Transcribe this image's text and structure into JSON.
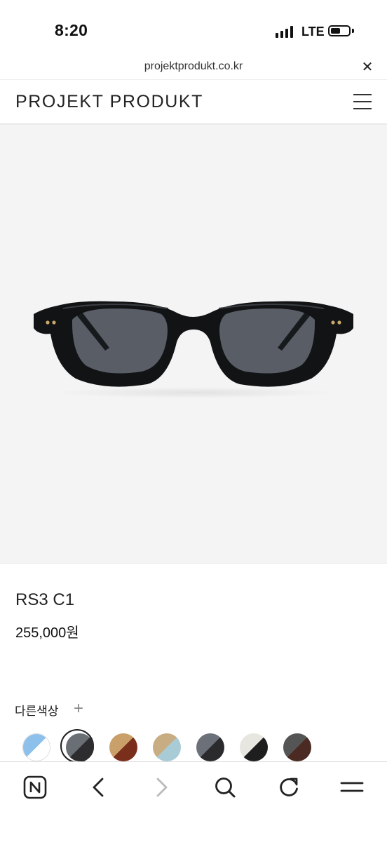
{
  "status_bar": {
    "time": "8:20",
    "network": "LTE",
    "battery_level": 0.55
  },
  "browser": {
    "url": "projektprodukt.co.kr",
    "close_icon": "close-icon"
  },
  "header": {
    "brand": "PROJEKT PRODUKT",
    "menu_icon": "hamburger-menu-icon"
  },
  "product": {
    "name": "RS3 C1",
    "price": "255,000원",
    "image": "black-sunglasses-photo"
  },
  "other_colors": {
    "label": "다른색상",
    "expand_symbol": "+",
    "swatches": [
      {
        "id": "swatch-1",
        "colors": [
          "#8dc0ea",
          "#ffffff"
        ],
        "selected": false
      },
      {
        "id": "swatch-2",
        "colors": [
          "#6a6e75",
          "#2d2d30"
        ],
        "selected": true
      },
      {
        "id": "swatch-3",
        "colors": [
          "#c9a069",
          "#7a2f1c"
        ],
        "selected": false
      },
      {
        "id": "swatch-4",
        "colors": [
          "#c8ad82",
          "#a8cbd6"
        ],
        "selected": false
      },
      {
        "id": "swatch-5",
        "colors": [
          "#6c7079",
          "#2b2b2e"
        ],
        "selected": false
      },
      {
        "id": "swatch-6",
        "colors": [
          "#e8e6e0",
          "#1e1e1e"
        ],
        "selected": false
      },
      {
        "id": "swatch-7",
        "colors": [
          "#555555",
          "#4a2a22"
        ],
        "selected": false
      }
    ]
  },
  "toolbar": {
    "items": [
      {
        "name": "naver-home-icon",
        "enabled": true
      },
      {
        "name": "back-arrow-icon",
        "enabled": true
      },
      {
        "name": "forward-arrow-icon",
        "enabled": false
      },
      {
        "name": "search-icon",
        "enabled": true
      },
      {
        "name": "refresh-icon",
        "enabled": true
      },
      {
        "name": "menu-icon",
        "enabled": true
      }
    ]
  }
}
